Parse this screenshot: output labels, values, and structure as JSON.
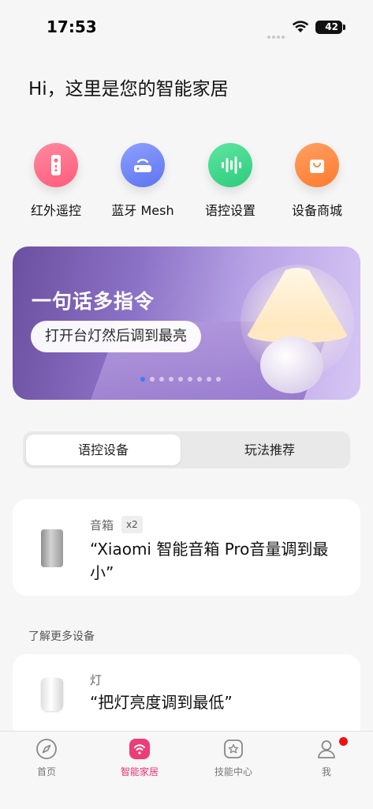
{
  "status": {
    "time": "17:53",
    "battery": "42"
  },
  "greeting": "Hi，这里是您的智能家居",
  "quick_actions": [
    {
      "label": "红外遥控",
      "icon": "remote-control-icon",
      "color": "#ff6f8b"
    },
    {
      "label": "蓝牙 Mesh",
      "icon": "router-icon",
      "color": "#6f84f5"
    },
    {
      "label": "语控设置",
      "icon": "voice-wave-icon",
      "color": "#3dd68a"
    },
    {
      "label": "设备商城",
      "icon": "shopping-bag-icon",
      "color": "#ff8a3a"
    }
  ],
  "banner": {
    "title": "一句话多指令",
    "subtitle": "打开台灯然后调到最亮",
    "dot_count": 9,
    "active_dot": 0
  },
  "tabs": [
    {
      "label": "语控设备",
      "active": true
    },
    {
      "label": "玩法推荐",
      "active": false
    }
  ],
  "devices": [
    {
      "category": "音箱",
      "count": "x2",
      "command": "“Xiaomi 智能音箱 Pro音量调到最小”",
      "icon": "speaker-icon"
    }
  ],
  "more_section": {
    "label": "了解更多设备",
    "devices": [
      {
        "category": "灯",
        "command": "“把灯亮度调到最低”",
        "icon": "light-icon"
      }
    ]
  },
  "nav": [
    {
      "label": "首页",
      "icon": "compass-icon",
      "active": false
    },
    {
      "label": "智能家居",
      "icon": "smart-home-icon",
      "active": true
    },
    {
      "label": "技能中心",
      "icon": "skill-star-icon",
      "active": false
    },
    {
      "label": "我",
      "icon": "profile-icon",
      "active": false,
      "has_badge": true
    }
  ],
  "colors": {
    "accent": "#e8336e",
    "background": "#f6f6f6"
  }
}
